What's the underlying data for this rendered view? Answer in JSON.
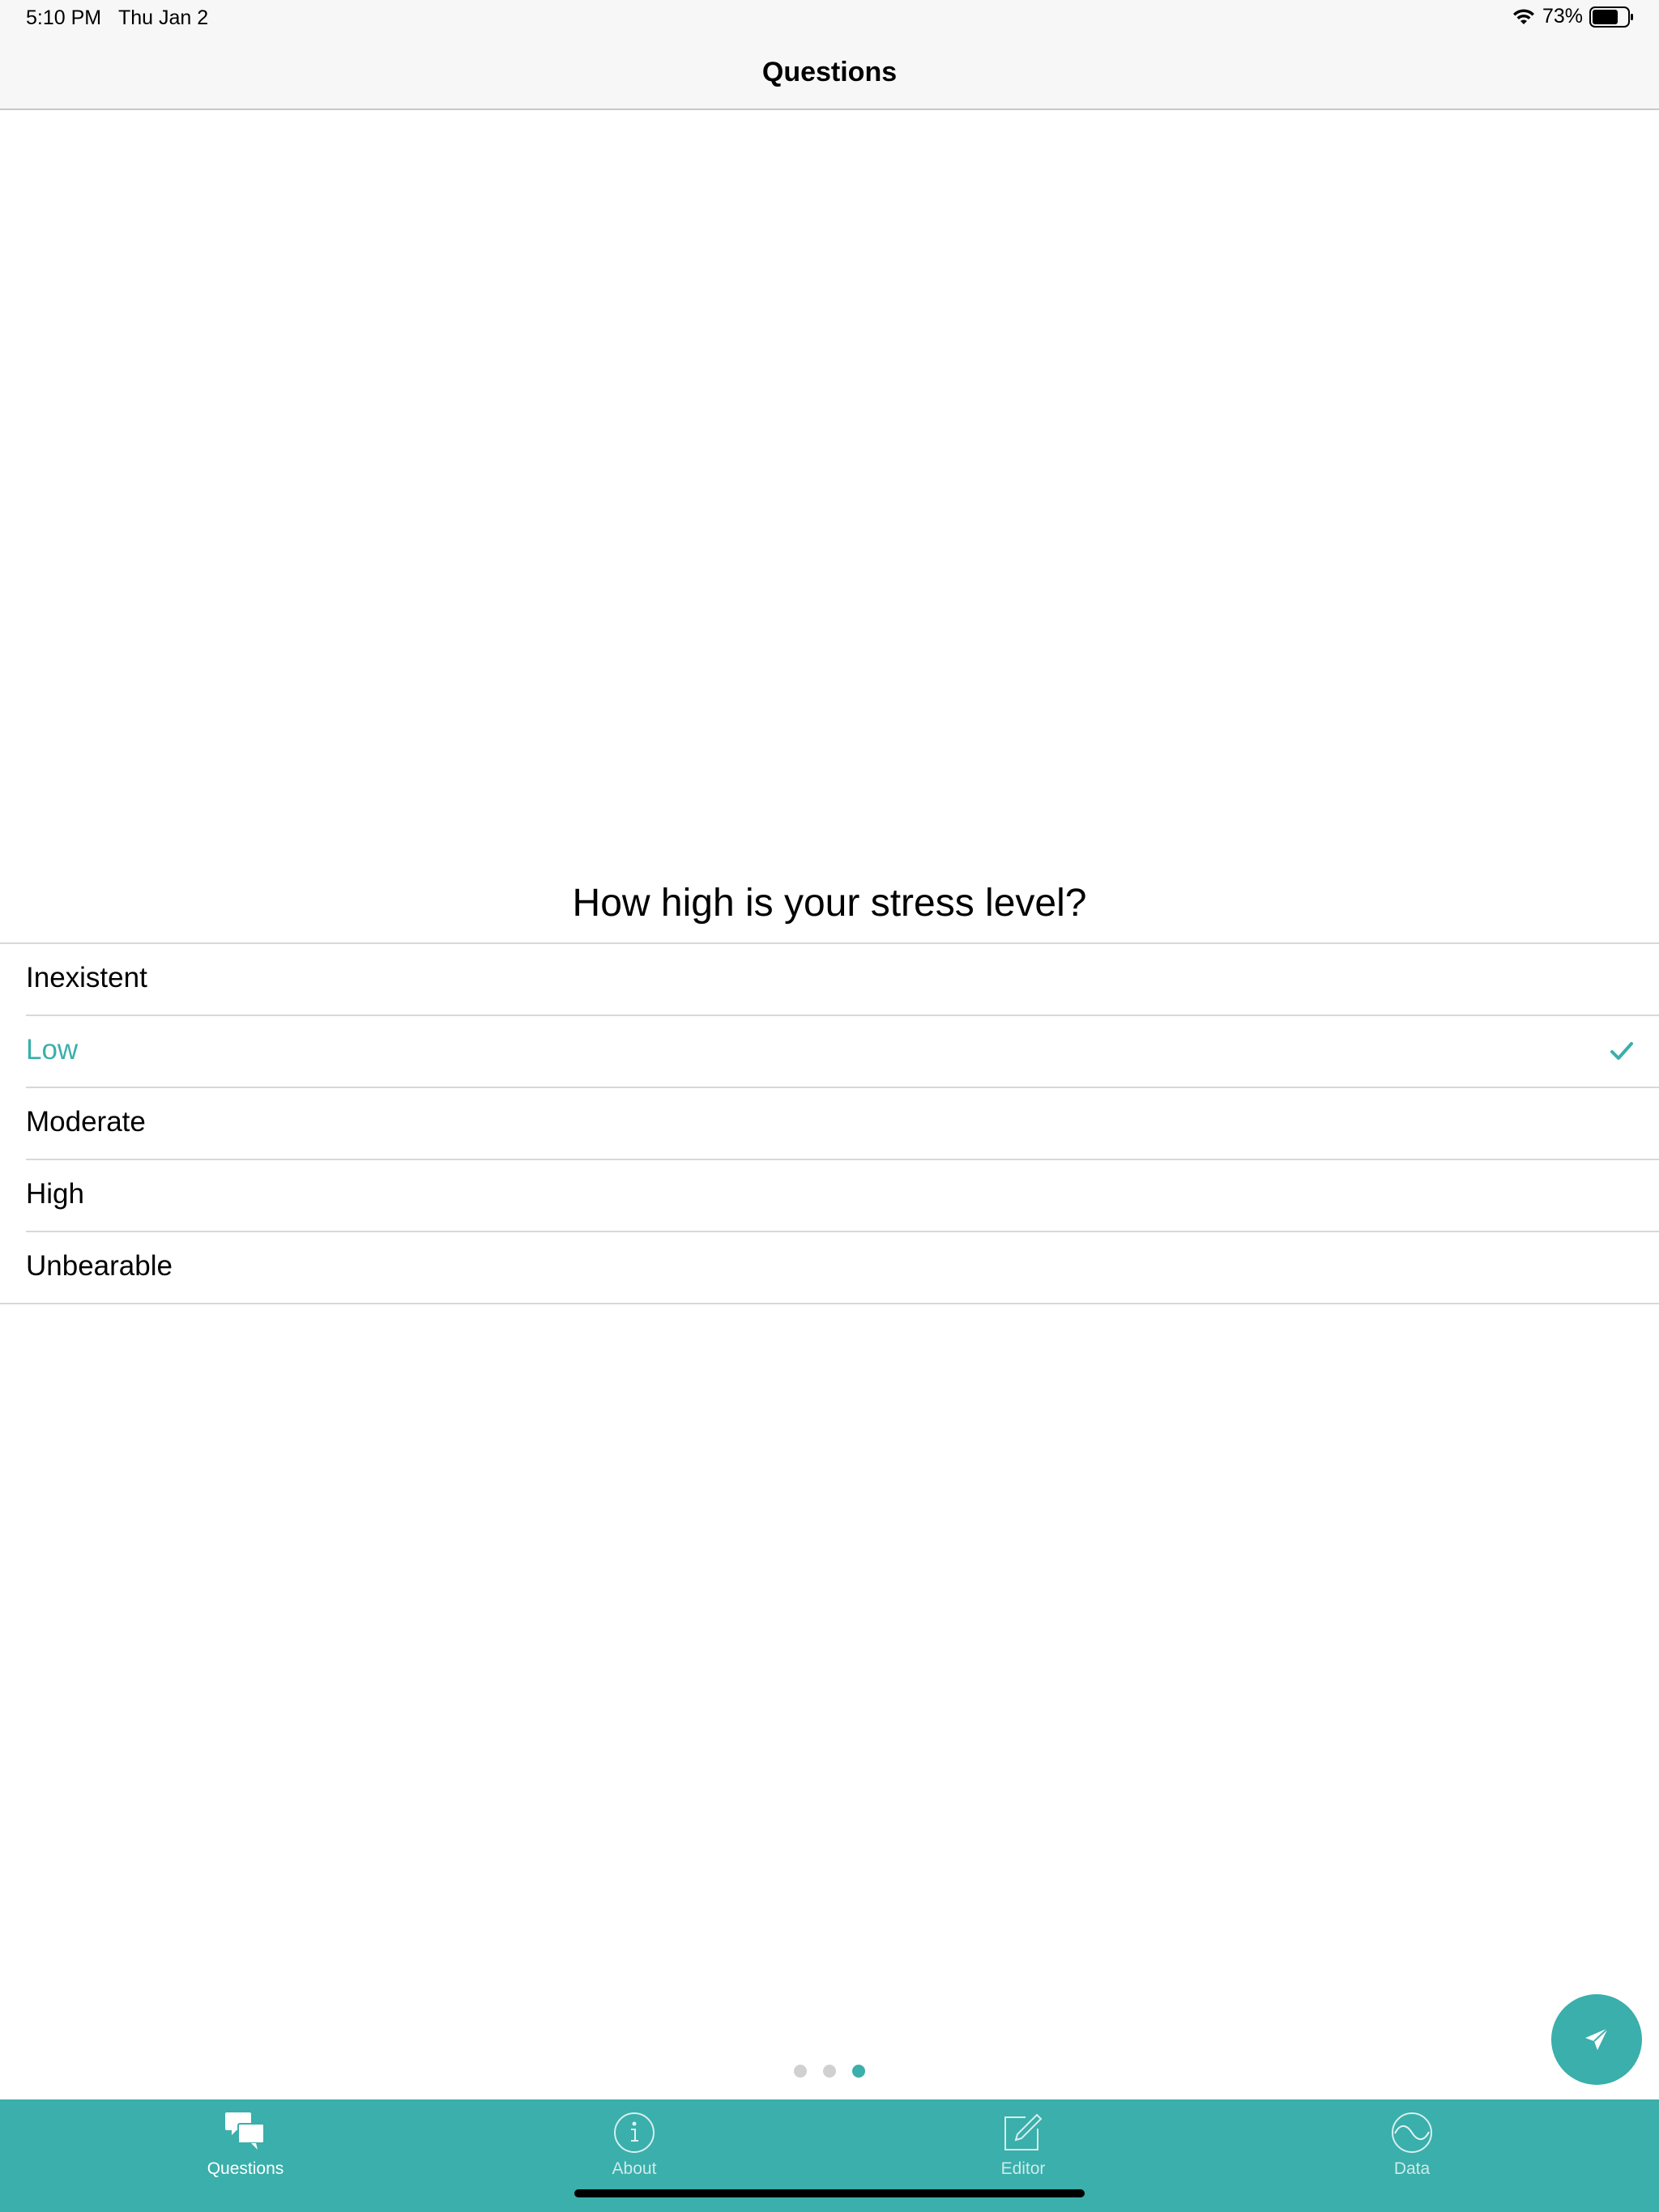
{
  "status": {
    "time": "5:10 PM",
    "date": "Thu Jan 2",
    "battery": "73%",
    "battery_level": 0.73
  },
  "nav": {
    "title": "Questions"
  },
  "question": {
    "text": "How high is your stress level?",
    "options": [
      {
        "label": "Inexistent",
        "selected": false
      },
      {
        "label": "Low",
        "selected": true
      },
      {
        "label": "Moderate",
        "selected": false
      },
      {
        "label": "High",
        "selected": false
      },
      {
        "label": "Unbearable",
        "selected": false
      }
    ]
  },
  "pager": {
    "count": 3,
    "current": 3
  },
  "tabs": [
    {
      "label": "Questions",
      "icon": "chat-bubbles-icon",
      "active": true
    },
    {
      "label": "About",
      "icon": "info-icon",
      "active": false
    },
    {
      "label": "Editor",
      "icon": "edit-icon",
      "active": false
    },
    {
      "label": "Data",
      "icon": "wave-icon",
      "active": false
    }
  ],
  "colors": {
    "accent": "#3aafab",
    "separator": "#d8d8d8",
    "bar": "#f7f7f7"
  },
  "fab": {
    "icon": "send-icon"
  }
}
